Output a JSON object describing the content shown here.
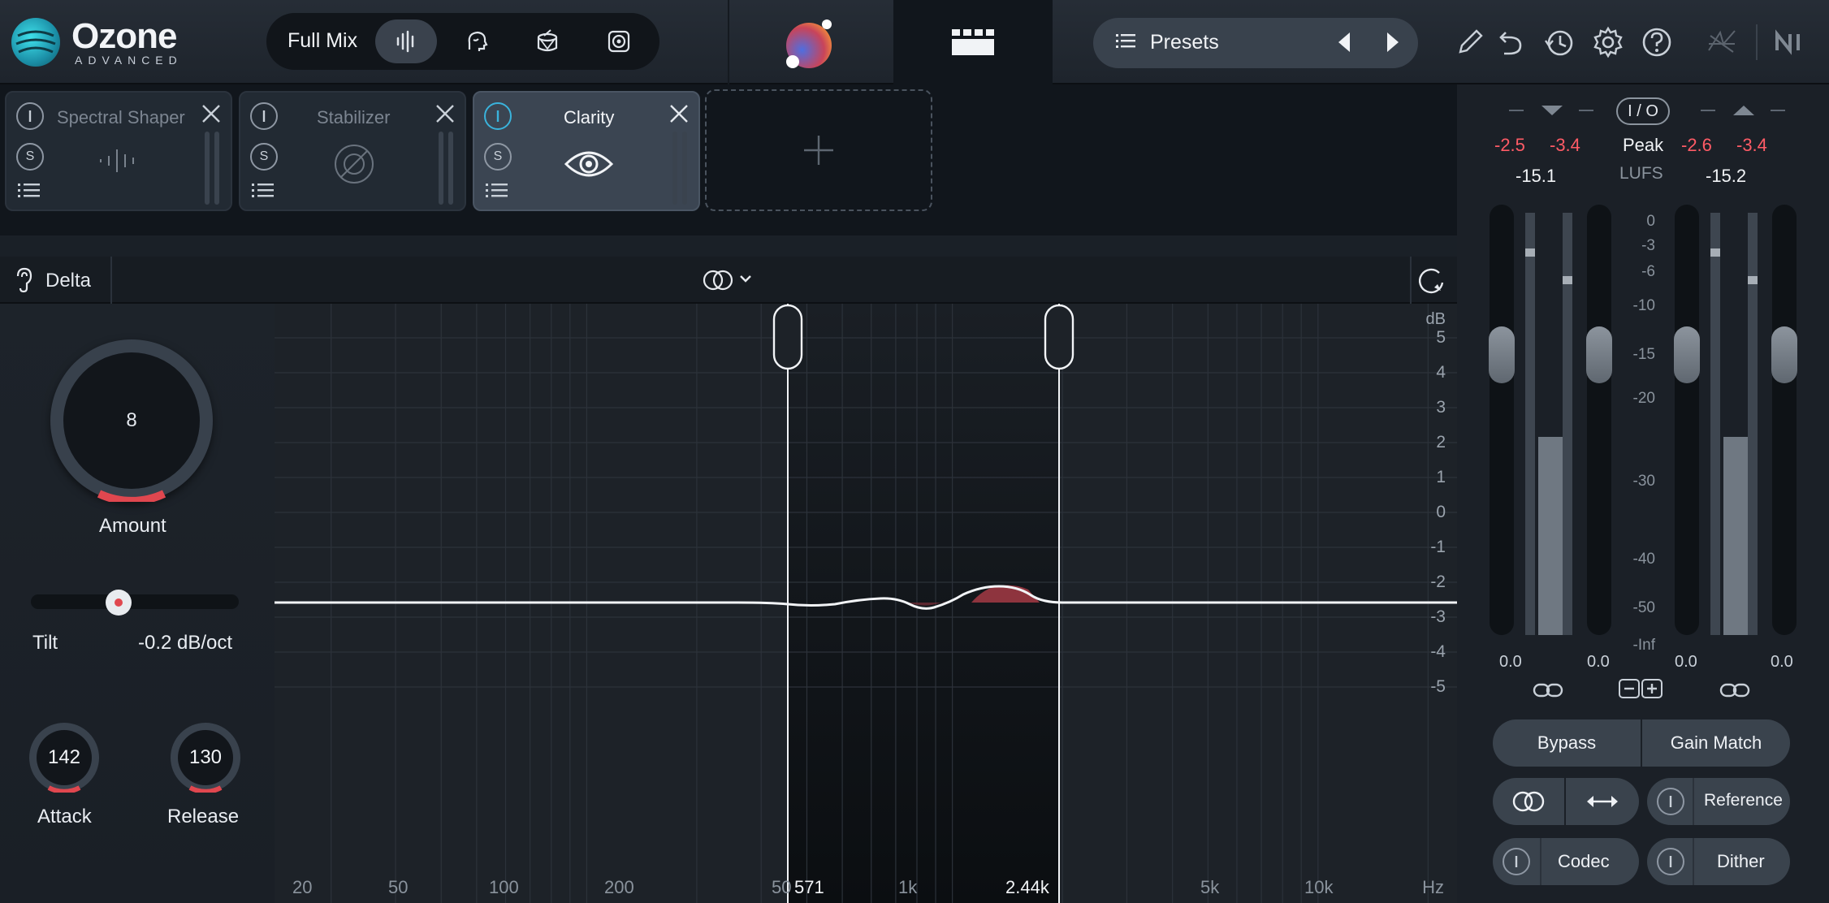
{
  "logo": {
    "title": "Ozone",
    "subtitle": "ADVANCED"
  },
  "assistant": {
    "label": "Full Mix",
    "icons": [
      "waveform-icon",
      "vocal-head-icon",
      "drum-icon",
      "speaker-icon"
    ]
  },
  "presets": {
    "label": "Presets"
  },
  "toolbar_icons": [
    "pencil-icon",
    "undo-icon",
    "history-icon",
    "gear-icon",
    "help-icon",
    "izotope-logo-icon",
    "ni-logo-icon"
  ],
  "modules": [
    {
      "name": "Spectral Shaper",
      "active": false,
      "power": "off"
    },
    {
      "name": "Stabilizer",
      "active": false,
      "power": "off"
    },
    {
      "name": "Clarity",
      "active": true,
      "power": "on"
    }
  ],
  "module_buttons": {
    "solo": "S"
  },
  "delta": {
    "label": "Delta"
  },
  "controls": {
    "amount": {
      "value": "8",
      "label": "Amount"
    },
    "tilt": {
      "label": "Tilt",
      "value": "-0.2 dB/oct",
      "position": 0.42
    },
    "attack": {
      "value": "142",
      "label": "Attack"
    },
    "release": {
      "value": "130",
      "label": "Release"
    }
  },
  "graph": {
    "db_unit": "dB",
    "db_ticks": [
      "5",
      "4",
      "3",
      "2",
      "1",
      "0",
      "-1",
      "-2",
      "-3",
      "-4",
      "-5"
    ],
    "freq_ticks": [
      "20",
      "50",
      "100",
      "200",
      "50",
      "571",
      "1k",
      "2.44k",
      "5k",
      "10k"
    ],
    "freq_unit": "Hz",
    "band_low": "571",
    "band_high": "2.44k"
  },
  "meters": {
    "io_label": "I / O",
    "left_peaks": [
      "-2.5",
      "-3.4"
    ],
    "right_peaks": [
      "-2.6",
      "-3.4"
    ],
    "left_lufs": "-15.1",
    "right_lufs": "-15.2",
    "center_label": "Peak",
    "center_sub": "LUFS",
    "scale": [
      "0",
      "-3",
      "-6",
      "-10",
      "-15",
      "-20",
      "-30",
      "-40",
      "-50",
      "-Inf"
    ],
    "gains": [
      "0.0",
      "0.0",
      "0.0",
      "0.0"
    ],
    "in_level": 0.47,
    "out_level": 0.47,
    "peak_color": "#ff5b66"
  },
  "bottom_buttons": {
    "bypass": "Bypass",
    "gain_match": "Gain Match",
    "reference": "Reference",
    "codec": "Codec",
    "dither": "Dither"
  }
}
